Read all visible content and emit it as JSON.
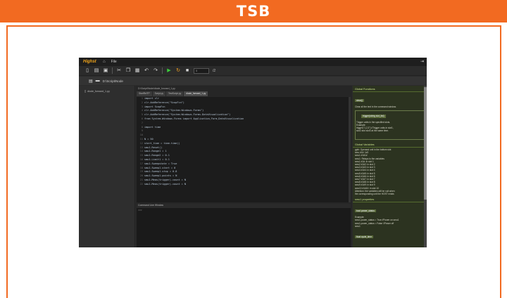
{
  "banner": {
    "title": "TSB"
  },
  "app": {
    "logo": "Highst",
    "menu": {
      "file": "File"
    },
    "toolbar": {
      "field_value": "5",
      "suffix": "/2"
    },
    "path": "D:\\Script\\Node",
    "sidebar": {
      "files": [
        "diode_forward_1.py"
      ]
    },
    "editor": {
      "filepath": "D:\\Script\\Node\\diode_forward_1.py",
      "tabs": [
        "StartRelTP",
        "Script.py",
        "TestScript.py",
        "diode_forward_1.py"
      ],
      "active_tab": 3,
      "lines": [
        "import clr",
        "clr.AddReference(\"ScopFcn\")",
        "import ScopFcn",
        "clr.AddReference(\"System.Windows.Forms\")",
        "clr.AddReference(\"System.Windows.Forms.DataVisualization\")",
        "from System.Windows.Forms import Application,Form,DataVisualization",
        "",
        "import time",
        "",
        "",
        "N = 50",
        "start_time = time.time()",
        "smu1.Reset()",
        "smu1.Range1 = 1",
        "smu1.Range2 = 0.1",
        "smu1.Limit1 = 0.1",
        "smu1.Sweepstate = True",
        "smu1.Sweep1.start = 0",
        "smu1.Sweep1.stop = 0.8",
        "smu1.Sweep1.points = N",
        "smu1.Meas(trigger).count = N",
        "smu1.Meas(trigger).count = N"
      ],
      "console_title": "Command Line Window",
      "console_text": ">>>"
    },
    "right_panel": {
      "functions_header": "Global Functions",
      "clear_label": "clear()",
      "clear_desc": "Clear all the text in the command window.",
      "trigger_label": "trigger(string slot_list)",
      "trigger_desc": "Trigger units in the specified slots.\nExample:\ntrigger(\"1,2,3\") //Trigger units in slot1,\nslot2 and slot3 at the same time.",
      "variables_header": "Global Variables",
      "variables_text": "gpib: Operand unit in the bottom slot\nsmu #1#: 1#2\nsmu1 #1#1#\nsmu1: Relays to the variables\nsmu1 #1#: in slot 1\nsmu2 #1#2: in slot 2\nsmu3 #1#3: in slot 3\nsmu4 #1#4: in slot 4\nsmu5 #1#5: in slot 5\nsmu6 #1#6: in slot 6\nsmu7 #1#7: in slot 7\nsmu8 #1#8: in slot 8\nsmu9 #1#9: in slot 9\nsmu10 #1#10: in slot 10\nAttention: the variables will be null when\nthe corresponding unit the HOST exists",
      "props_header": "smu1 properties",
      "prop_label": "bool power_status",
      "prop_text": "Example:\nsmu1.power_status = True //Power on smu1\nsmu1.power_status = False //Power off\nsmu1",
      "last_label": "float cycle_time"
    }
  }
}
